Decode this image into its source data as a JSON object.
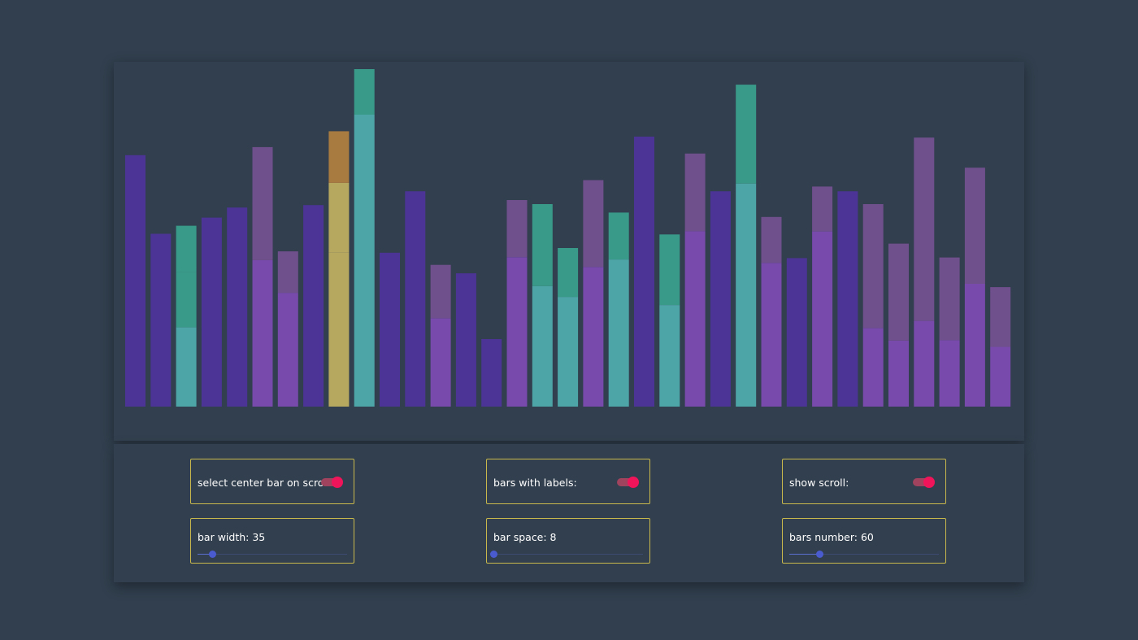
{
  "colors": {
    "bar_dark": "#4c3497",
    "bar_purple": "#774aab",
    "bar_mauve": "#704f8d",
    "bar_teal": "#3a9a8a",
    "bar_teal_light": "#4ea5a7",
    "bar_selected": "#b7a860",
    "bar_selected_top": "#a87b40",
    "accent_border": "#c9b94c",
    "toggle_on": "#f0145a",
    "slider": "#4a5bd0"
  },
  "chart_data": {
    "type": "bar",
    "stacked": true,
    "grid": false,
    "ylim": [
      0,
      100
    ],
    "selected_index": 8,
    "values": [
      74.5,
      51.2,
      53.6,
      56.0,
      59.0,
      76.9,
      46.0,
      59.7,
      81.6,
      100.0,
      45.6,
      63.8,
      42.0,
      39.5,
      20.0,
      61.2,
      60.0,
      47.0,
      67.1,
      57.5,
      80.0,
      51.0,
      75.0,
      63.8,
      95.4,
      56.2,
      44.0,
      65.2,
      63.8,
      60.0,
      48.3,
      79.7,
      44.2,
      70.8,
      35.4
    ],
    "segments": [
      [
        [
          "dark",
          74.5
        ]
      ],
      [
        [
          "dark",
          51.2
        ]
      ],
      [
        [
          "teal_light",
          23.5
        ],
        [
          "teal",
          16.3
        ],
        [
          "teal",
          13.8
        ]
      ],
      [
        [
          "dark",
          56.0
        ]
      ],
      [
        [
          "dark",
          59.0
        ]
      ],
      [
        [
          "purple",
          43.4
        ],
        [
          "mauve",
          33.5
        ]
      ],
      [
        [
          "purple",
          33.7
        ],
        [
          "mauve",
          12.3
        ]
      ],
      [
        [
          "dark",
          59.7
        ]
      ],
      [
        [
          "selected",
          45.6
        ],
        [
          "selected",
          20.7
        ],
        [
          "selected_top",
          15.3
        ]
      ],
      [
        [
          "teal_light",
          86.5
        ],
        [
          "teal",
          13.5
        ]
      ],
      [
        [
          "dark",
          45.6
        ]
      ],
      [
        [
          "dark",
          63.8
        ]
      ],
      [
        [
          "purple",
          26.2
        ],
        [
          "mauve",
          15.8
        ]
      ],
      [
        [
          "dark",
          39.5
        ]
      ],
      [
        [
          "dark",
          20.0
        ]
      ],
      [
        [
          "purple",
          44.3
        ],
        [
          "mauve",
          16.9
        ]
      ],
      [
        [
          "teal_light",
          35.7
        ],
        [
          "teal",
          24.3
        ]
      ],
      [
        [
          "teal_light",
          32.5
        ],
        [
          "teal",
          14.5
        ]
      ],
      [
        [
          "purple",
          41.4
        ],
        [
          "mauve",
          25.7
        ]
      ],
      [
        [
          "teal_light",
          43.6
        ],
        [
          "teal",
          13.9
        ]
      ],
      [
        [
          "dark",
          80.0
        ]
      ],
      [
        [
          "teal_light",
          30.1
        ],
        [
          "teal",
          20.9
        ]
      ],
      [
        [
          "purple",
          52.0
        ],
        [
          "mauve",
          23.0
        ]
      ],
      [
        [
          "dark",
          63.8
        ]
      ],
      [
        [
          "teal_light",
          66.1
        ],
        [
          "teal",
          29.3
        ]
      ],
      [
        [
          "purple",
          42.6
        ],
        [
          "mauve",
          13.6
        ]
      ],
      [
        [
          "dark",
          44.0
        ]
      ],
      [
        [
          "purple",
          51.9
        ],
        [
          "mauve",
          13.3
        ]
      ],
      [
        [
          "dark",
          63.8
        ]
      ],
      [
        [
          "purple",
          23.3
        ],
        [
          "mauve",
          36.7
        ]
      ],
      [
        [
          "purple",
          19.6
        ],
        [
          "mauve",
          28.7
        ]
      ],
      [
        [
          "purple",
          25.4
        ],
        [
          "mauve",
          54.3
        ]
      ],
      [
        [
          "purple",
          19.7
        ],
        [
          "mauve",
          24.5
        ]
      ],
      [
        [
          "purple",
          36.4
        ],
        [
          "mauve",
          34.4
        ]
      ],
      [
        [
          "purple",
          17.7
        ],
        [
          "mauve",
          17.7
        ]
      ]
    ]
  },
  "controls": {
    "select_center": {
      "label": "select center bar on scroll:",
      "on": true
    },
    "bars_with_labels": {
      "label": "bars with labels:",
      "on": true
    },
    "show_scroll": {
      "label": "show scroll:",
      "on": true
    },
    "bar_width": {
      "label": "bar width: 35",
      "value": 35,
      "level": 0.1
    },
    "bar_space": {
      "label": "bar space: 8",
      "value": 8,
      "level": 0.0
    },
    "bars_number": {
      "label": "bars number: 60",
      "value": 60,
      "level": 0.2
    }
  }
}
